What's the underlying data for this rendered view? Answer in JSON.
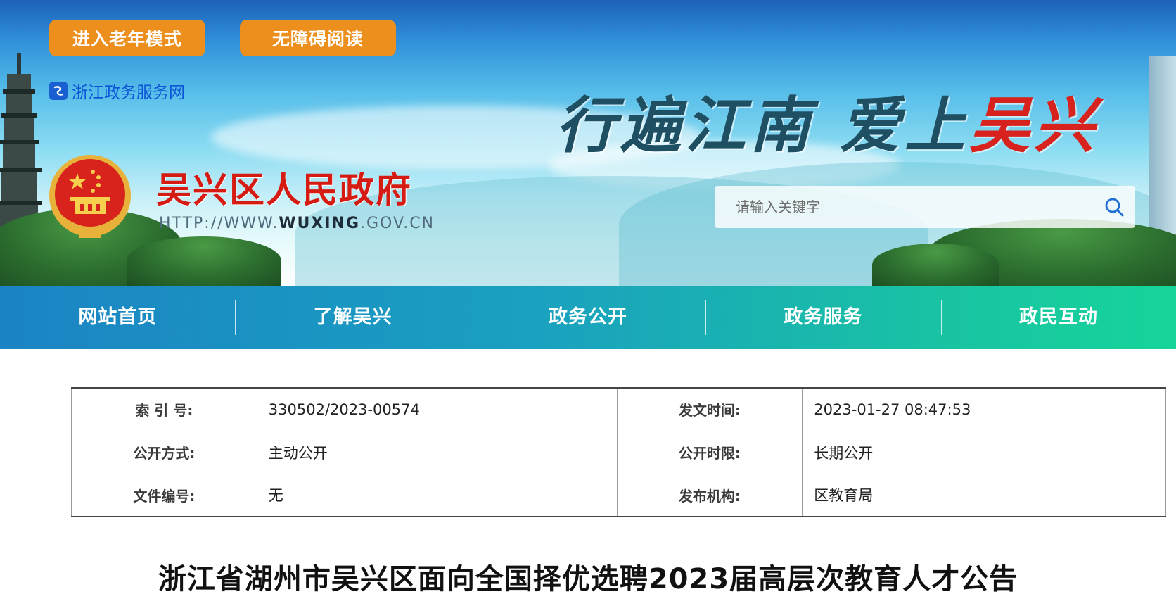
{
  "header": {
    "elder_mode_label": "进入老年模式",
    "accessible_label": "无障碍阅读",
    "zj_service_link": "浙江政务服务网",
    "site_title": "吴兴区人民政府",
    "site_url_prefix": "HTTP://WWW.",
    "site_url_domain": "WUXING",
    "site_url_suffix": ".GOV.CN",
    "slogan_part1": "行遍江南 爱上",
    "slogan_part2": "吴兴",
    "search": {
      "placeholder": "请输入关键字",
      "icon": "search-icon"
    }
  },
  "nav": {
    "items": [
      {
        "label": "网站首页"
      },
      {
        "label": "了解吴兴"
      },
      {
        "label": "政务公开"
      },
      {
        "label": "政务服务"
      },
      {
        "label": "政民互动"
      }
    ]
  },
  "info_table": {
    "rows": [
      {
        "label_a": "索 引 号:",
        "value_a": "330502/2023-00574",
        "label_b": "发文时间:",
        "value_b": "2023-01-27 08:47:53"
      },
      {
        "label_a": "公开方式:",
        "value_a": "主动公开",
        "label_b": "公开时限:",
        "value_b": "长期公开"
      },
      {
        "label_a": "文件编号:",
        "value_a": "无",
        "label_b": "发布机构:",
        "value_b": "区教育局"
      }
    ]
  },
  "article": {
    "title": "浙江省湖州市吴兴区面向全国择优选聘2023届高层次教育人才公告"
  },
  "colors": {
    "accent_orange": "#ec8f1c",
    "title_red": "#d61b12",
    "nav_start": "#1b84c4",
    "nav_end": "#16d49a"
  }
}
